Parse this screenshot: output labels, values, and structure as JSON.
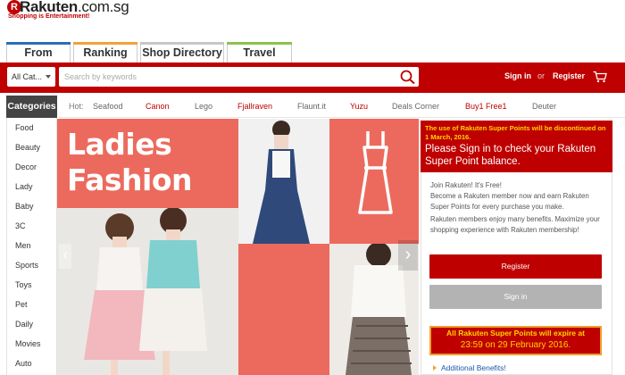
{
  "brand": {
    "logo_mark": "R",
    "name_bold": "Rakuten",
    "name_domain": ".com.sg",
    "tagline": "Shopping is Entertainment!"
  },
  "tabs": [
    {
      "label": "From Japan"
    },
    {
      "label": "Ranking"
    },
    {
      "label": "Shop Directory"
    },
    {
      "label": "Travel"
    }
  ],
  "search": {
    "category": "All Cat...",
    "placeholder": "Search by keywords"
  },
  "account": {
    "signin": "Sign in",
    "or": "or",
    "register": "Register"
  },
  "categories": {
    "heading": "Categories",
    "items": [
      "Food",
      "Beauty",
      "Decor",
      "Lady",
      "Baby",
      "3C",
      "Men",
      "Sports",
      "Toys",
      "Pet",
      "Daily",
      "Movies",
      "Auto"
    ]
  },
  "hot": {
    "label": "Hot:",
    "items": [
      {
        "text": "Seafood",
        "color": "#666666"
      },
      {
        "text": "Canon",
        "color": "#bf0000"
      },
      {
        "text": "Lego",
        "color": "#666666"
      },
      {
        "text": "Fjallraven",
        "color": "#bf0000"
      },
      {
        "text": "Flaunt.it",
        "color": "#666666"
      },
      {
        "text": "Yuzu",
        "color": "#bf0000"
      },
      {
        "text": "Deals Corner",
        "color": "#666666"
      },
      {
        "text": "Buy1 Free1",
        "color": "#bf0000"
      },
      {
        "text": "Deuter",
        "color": "#666666"
      }
    ]
  },
  "banner": {
    "line1": "Ladies",
    "line2": "Fashion"
  },
  "notice": {
    "small": "The use of Rakuten Super Points will be discontinued on 1 March, 2016.",
    "big": "Please Sign in to check your Rakuten Super Point balance."
  },
  "join": {
    "line1": "Join Rakuten! It's Free!",
    "line2": "Become a Rakuten member now and earn Rakuten Super Points for every purchase you make.",
    "line3": "Rakuten members enjoy many benefits. Maximize your shopping experience with Rakuten membership!",
    "register_btn": "Register",
    "signin_btn": "Sign in"
  },
  "expiry": {
    "line1": "All Rakuten Super Points will expire at",
    "line2": "23:59 on 29 February 2016."
  },
  "benefits": "Additional Benefits!",
  "colors": {
    "brand_red": "#bf0000",
    "banner_coral": "#ec6a5d",
    "highlight_yellow": "#ffd400",
    "link_blue": "#1a56b0"
  }
}
